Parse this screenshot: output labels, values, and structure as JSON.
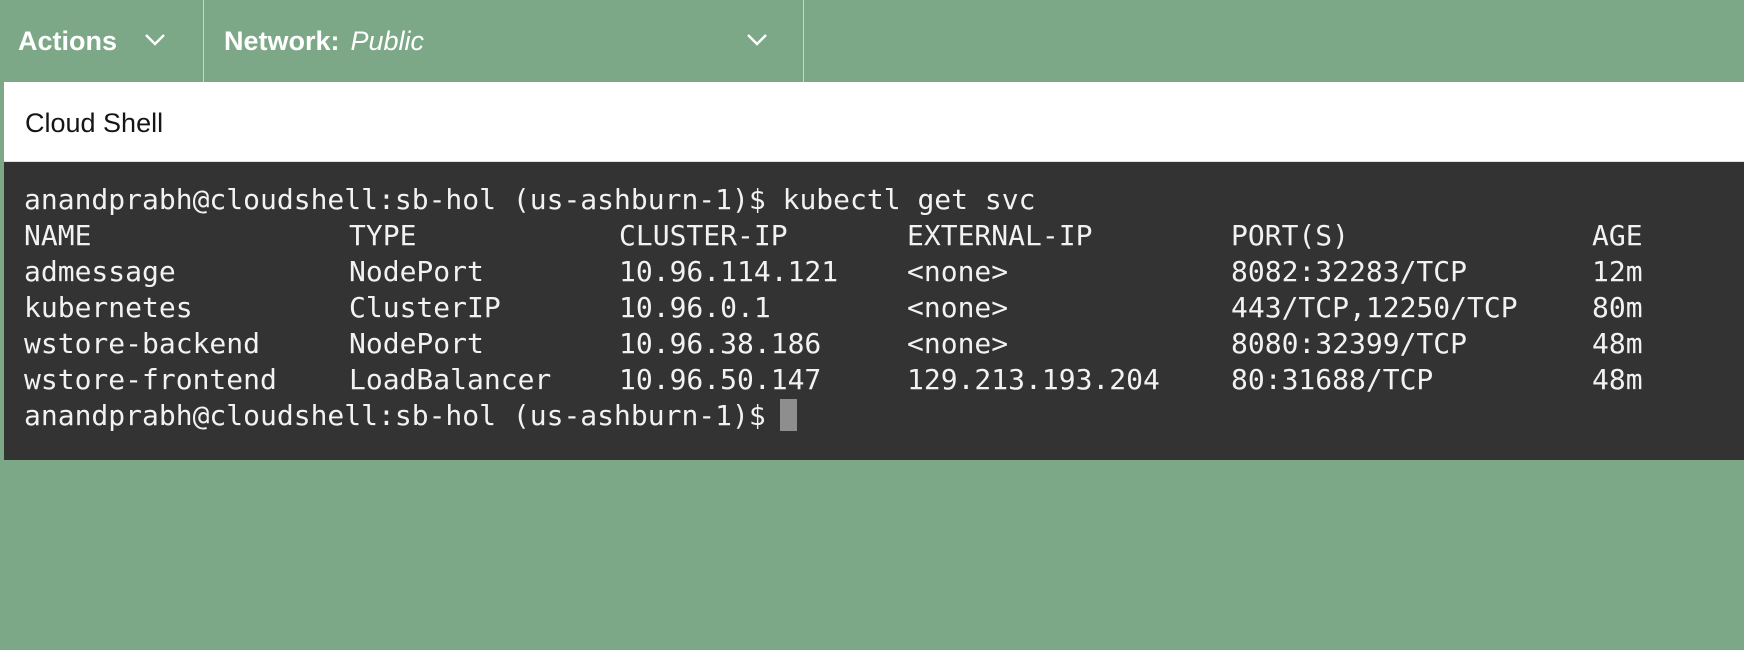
{
  "toolbar": {
    "actions_label": "Actions",
    "network_label": "Network:",
    "network_value": "Public"
  },
  "shell": {
    "title": "Cloud Shell"
  },
  "terminal": {
    "prompt": "anandprabh@cloudshell:sb-hol (us-ashburn-1)$",
    "command": "kubectl get svc",
    "headers": [
      "NAME",
      "TYPE",
      "CLUSTER-IP",
      "EXTERNAL-IP",
      "PORT(S)",
      "AGE"
    ],
    "rows": [
      [
        "admessage",
        "NodePort",
        "10.96.114.121",
        "<none>",
        "8082:32283/TCP",
        "12m"
      ],
      [
        "kubernetes",
        "ClusterIP",
        "10.96.0.1",
        "<none>",
        "443/TCP,12250/TCP",
        "80m"
      ],
      [
        "wstore-backend",
        "NodePort",
        "10.96.38.186",
        "<none>",
        "8080:32399/TCP",
        "48m"
      ],
      [
        "wstore-frontend",
        "LoadBalancer",
        "10.96.50.147",
        "129.213.193.204",
        "80:31688/TCP",
        "48m"
      ]
    ]
  }
}
